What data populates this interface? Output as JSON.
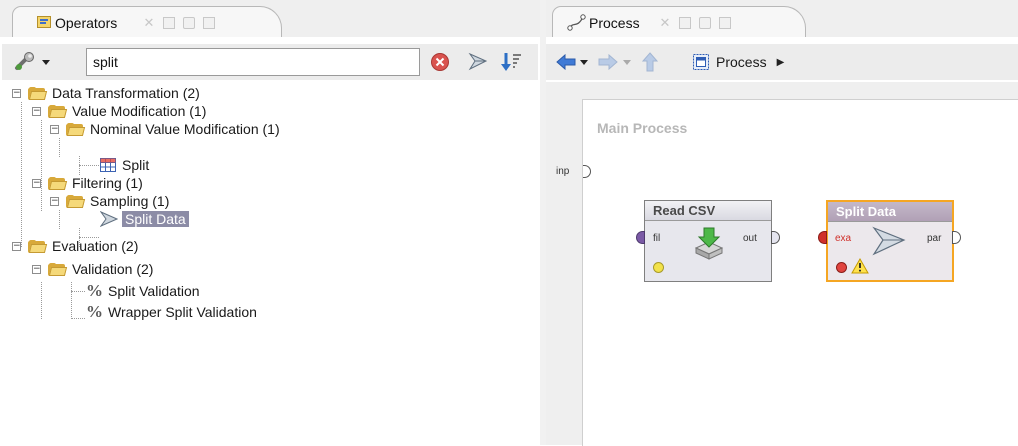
{
  "operators_tab": {
    "title": "Operators"
  },
  "search": {
    "value": "split"
  },
  "tree": {
    "data_transformation": "Data Transformation (2)",
    "value_modification": "Value Modification (1)",
    "nominal_value_modification": "Nominal Value Modification (1)",
    "split": "Split",
    "filtering": "Filtering (1)",
    "sampling": "Sampling (1)",
    "split_data": "Split Data",
    "evaluation": "Evaluation (2)",
    "validation": "Validation (2)",
    "split_validation": "Split Validation",
    "wrapper_split_validation": "Wrapper Split Validation"
  },
  "process_tab": {
    "title": "Process"
  },
  "breadcrumb": {
    "label": "Process"
  },
  "canvas": {
    "title": "Main Process",
    "input_port": "inp",
    "read_csv": {
      "title": "Read CSV",
      "in_port": "fil",
      "out_port": "out"
    },
    "split_data": {
      "title": "Split Data",
      "in_port": "exa",
      "out_port": "par"
    }
  },
  "icons": {
    "operators_tab": "operators-icon",
    "process_tab": "process-icon",
    "clear_search": "clear-icon",
    "filter": "funnel-icon",
    "sort": "sort-icon",
    "back": "arrow-left-icon",
    "forward": "arrow-right-icon",
    "up": "arrow-up-icon",
    "warning": "warning-icon"
  },
  "colors": {
    "selection": "#8c8ca6",
    "folder": "#f5d97a",
    "port_exa": "#d0302a",
    "port_data": "#7b5aa6",
    "split_data_border": "#f5a623",
    "status_yellow": "#f2e24a",
    "status_red": "#e0443f"
  }
}
